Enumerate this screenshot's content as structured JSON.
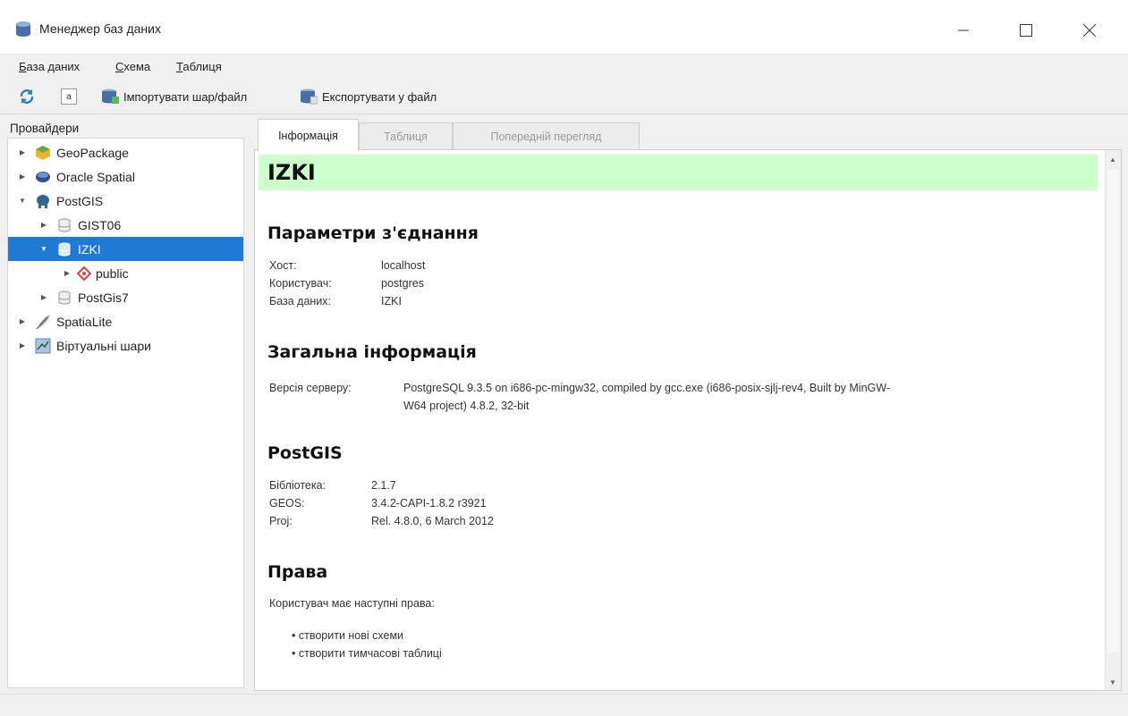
{
  "window": {
    "title": "Менеджер баз даних"
  },
  "menu": [
    {
      "pre": "",
      "u": "Б",
      "post": "аза даних"
    },
    {
      "pre": "",
      "u": "С",
      "post": "хема"
    },
    {
      "pre": "",
      "u": "Т",
      "post": "аблиця"
    }
  ],
  "toolbar": {
    "import_label": "Імпортувати шар/файл",
    "export_label": "Експортувати у файл",
    "sql_label": "a"
  },
  "providers": {
    "header": "Провайдери",
    "items": [
      {
        "label": "GeoPackage"
      },
      {
        "label": "Oracle Spatial"
      },
      {
        "label": "PostGIS"
      },
      {
        "label": "GIST06"
      },
      {
        "label": "IZKI"
      },
      {
        "label": "public"
      },
      {
        "label": "PostGis7"
      },
      {
        "label": "SpatiaLite"
      },
      {
        "label": "Віртуальні шари"
      }
    ]
  },
  "tabs": [
    {
      "label": "Інформація"
    },
    {
      "label": "Таблиця"
    },
    {
      "label": "Попередній перегляд"
    }
  ],
  "info": {
    "db_title": "IZKI",
    "connection": {
      "heading": "Параметри з'єднання",
      "rows": [
        {
          "k": "Хост:",
          "v": "localhost"
        },
        {
          "k": "Користувач:",
          "v": "postgres"
        },
        {
          "k": "База даних:",
          "v": "IZKI"
        }
      ]
    },
    "general": {
      "heading": "Загальна інформація",
      "server_key": "Версія серверу:",
      "server_line1": "PostgreSQL 9.3.5 on i686-pc-mingw32, compiled by gcc.exe (i686-posix-sjlj-rev4, Built by MinGW-",
      "server_line2": "W64 project) 4.8.2, 32-bit"
    },
    "postgis": {
      "heading": "PostGIS",
      "rows": [
        {
          "k": "Бібліотека:",
          "v": "2.1.7"
        },
        {
          "k": "GEOS:",
          "v": "3.4.2-CAPI-1.8.2 r3921"
        },
        {
          "k": "Proj:",
          "v": "Rel. 4.8.0, 6 March 2012"
        }
      ]
    },
    "rights": {
      "heading": "Права",
      "intro": "Користувач має наступні права:",
      "items": [
        "створити нові схеми",
        "створити тимчасові таблиці"
      ]
    }
  },
  "colors": {
    "selection": "#1f7ad4",
    "title_bg": "#ccffcc"
  }
}
